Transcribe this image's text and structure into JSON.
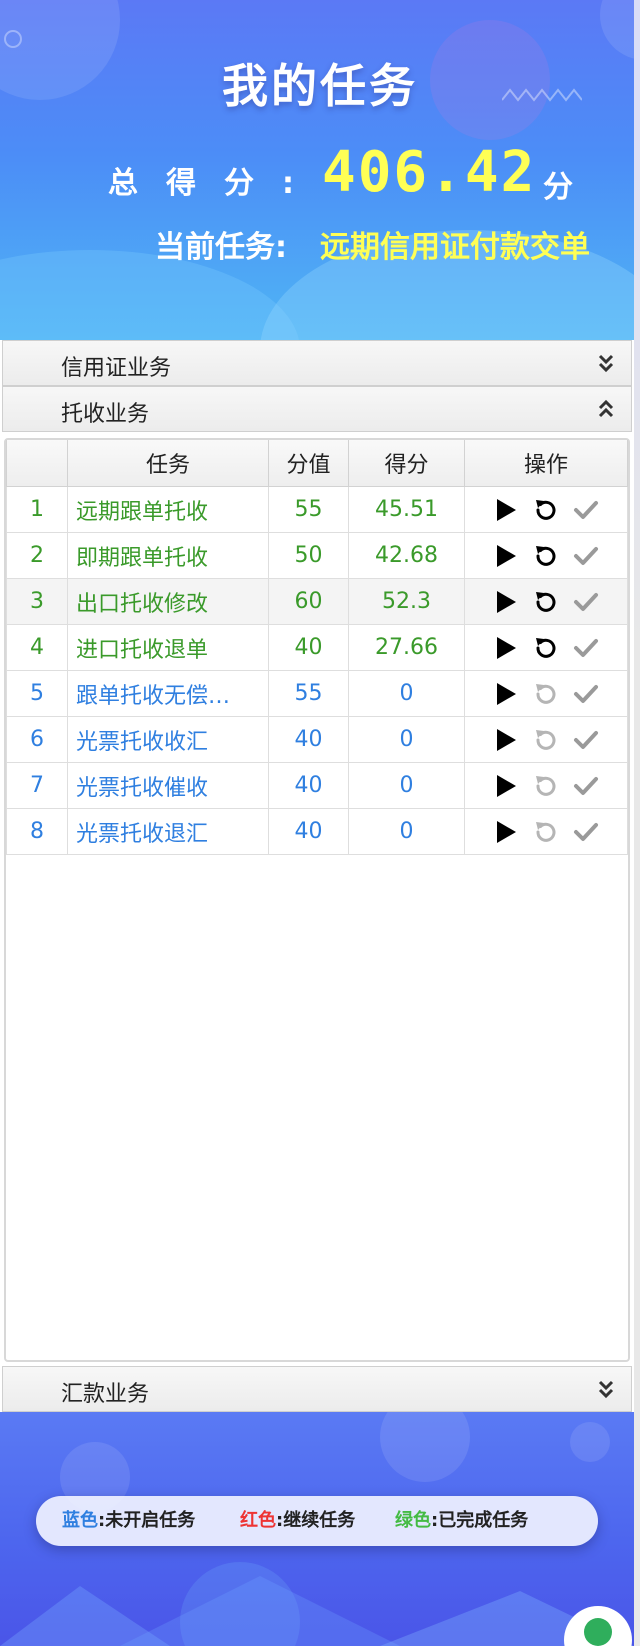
{
  "header": {
    "title": "我的任务",
    "score_label": "总得分:",
    "score_value": "406.42",
    "score_unit": "分",
    "current_task_label": "当前任务:",
    "current_task_value": "远期信用证付款交单"
  },
  "sections": [
    {
      "label": "信用证业务",
      "expanded": false
    },
    {
      "label": "托收业务",
      "expanded": true
    },
    {
      "label": "汇款业务",
      "expanded": false
    }
  ],
  "table": {
    "columns": [
      "",
      "任务",
      "分值",
      "得分",
      "操作"
    ],
    "rows": [
      {
        "index": "1",
        "name": "远期跟单托收",
        "value": "55",
        "score": "45.51",
        "status": "completed"
      },
      {
        "index": "2",
        "name": "即期跟单托收",
        "value": "50",
        "score": "42.68",
        "status": "completed"
      },
      {
        "index": "3",
        "name": "出口托收修改",
        "value": "60",
        "score": "52.3",
        "status": "completed"
      },
      {
        "index": "4",
        "name": "进口托收退单",
        "value": "40",
        "score": "27.66",
        "status": "completed"
      },
      {
        "index": "5",
        "name": "跟单托收无偿…",
        "value": "55",
        "score": "0",
        "status": "not_started"
      },
      {
        "index": "6",
        "name": "光票托收收汇",
        "value": "40",
        "score": "0",
        "status": "not_started"
      },
      {
        "index": "7",
        "name": "光票托收催收",
        "value": "40",
        "score": "0",
        "status": "not_started"
      },
      {
        "index": "8",
        "name": "光票托收退汇",
        "value": "40",
        "score": "0",
        "status": "not_started"
      }
    ]
  },
  "legend": {
    "blue_label": "蓝色",
    "blue_text": ":未开启任务",
    "red_label": "红色",
    "red_text": ":继续任务",
    "green_label": "绿色",
    "green_text": ":已完成任务"
  },
  "colors": {
    "completed": "#3a9a2a",
    "not_started": "#2f7fe0",
    "in_progress": "#e03030",
    "highlight": "#ffff55",
    "legend_blue": "#2f7fe0",
    "legend_red": "#ee3333",
    "legend_green": "#44bb44"
  },
  "icons": {
    "start": "play-icon",
    "restart": "restart-icon",
    "complete": "check-icon",
    "collapsed": "double-chevron-down-icon",
    "expanded": "double-chevron-up-icon"
  }
}
